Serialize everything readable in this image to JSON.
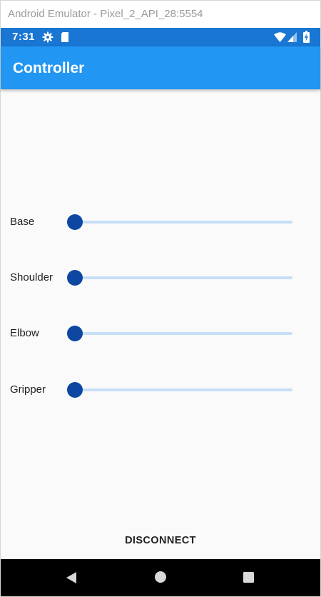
{
  "window": {
    "title": "Android Emulator - Pixel_2_API_28:5554"
  },
  "status_bar": {
    "time": "7:31",
    "icons": [
      "gear-icon",
      "sd-card-icon",
      "wifi-icon",
      "signal-icon",
      "battery-icon"
    ],
    "background": "#1976d2"
  },
  "app_bar": {
    "title": "Controller",
    "background": "#2196f3"
  },
  "sliders": [
    {
      "label": "Base",
      "value": 0
    },
    {
      "label": "Shoulder",
      "value": 0
    },
    {
      "label": "Elbow",
      "value": 0
    },
    {
      "label": "Gripper",
      "value": 0
    }
  ],
  "slider_colors": {
    "thumb": "#0d47a1",
    "track": "#c5dff8"
  },
  "actions": {
    "disconnect_label": "DISCONNECT"
  },
  "nav_bar": {
    "buttons": [
      "back-icon",
      "home-icon",
      "recents-icon"
    ]
  }
}
